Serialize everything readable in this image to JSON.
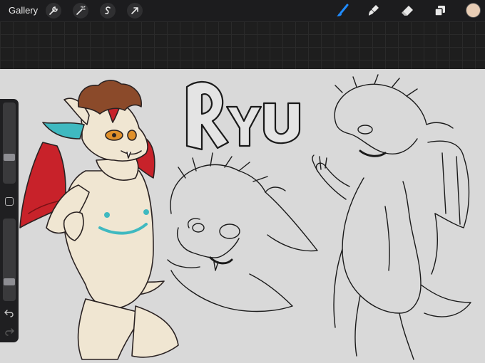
{
  "topbar": {
    "gallery_label": "Gallery",
    "left_tools": [
      "wrench-icon",
      "magic-wand-icon",
      "selection-s-icon",
      "transform-arrow-icon"
    ],
    "right_tools": [
      "brush-icon",
      "smudge-icon",
      "eraser-icon",
      "layers-icon"
    ],
    "active_tool": "brush-icon",
    "active_color": "#e8cdb5",
    "accent": "#1f8bff"
  },
  "sidebar": {
    "brush_size_level": 0.3,
    "opacity_level": 0.2,
    "actions": [
      "undo-arrow-icon",
      "redo-arrow-icon"
    ]
  },
  "canvas": {
    "background": "#d9d9d9",
    "title_text": "Ryu",
    "panels": [
      "colored-character-sketch",
      "head-sketch",
      "body-back-sketch"
    ],
    "colors": {
      "fur": "#f0e6d2",
      "hair": "#8b4a2a",
      "wing": "#c8222a",
      "accent_cyan": "#3fb9c0",
      "eye": "#e0902a"
    }
  }
}
